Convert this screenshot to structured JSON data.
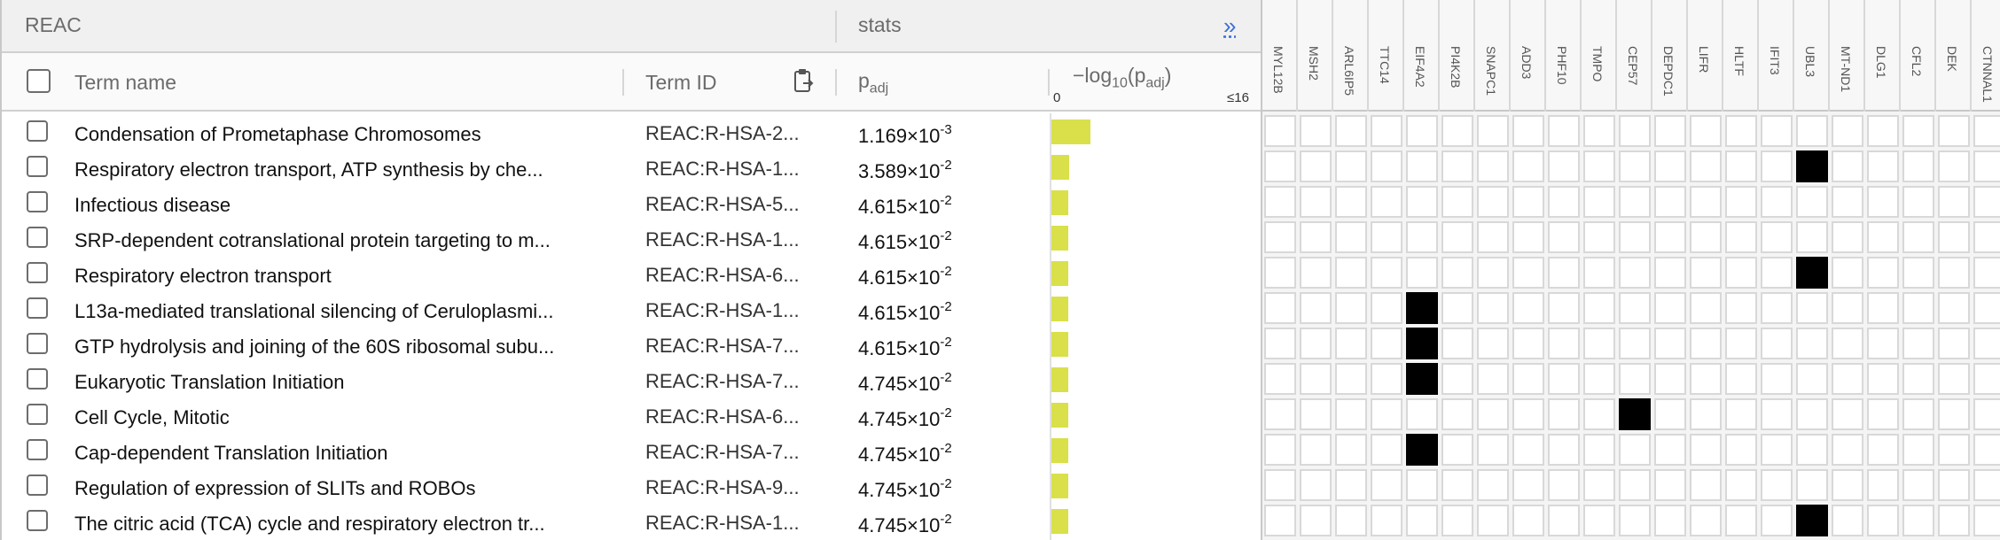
{
  "header": {
    "source": "REAC",
    "stats": "stats",
    "expand_glyph": "»"
  },
  "columns": {
    "term_name": "Term name",
    "term_id": "Term ID",
    "padj": "p",
    "padj_sub": "adj",
    "log_prefix": "−log",
    "log_base": "10",
    "log_open": "(p",
    "log_sub": "adj",
    "log_close": ")",
    "tick_min": "0",
    "tick_max": "≤16"
  },
  "rows": [
    {
      "name": "Condensation of Prometaphase Chromosomes",
      "id": "REAC:R-HSA-2...",
      "mant": "1.169×10",
      "exp": "-3",
      "bar": 1.0,
      "hits": []
    },
    {
      "name": "Respiratory electron transport, ATP synthesis by che...",
      "id": "REAC:R-HSA-1...",
      "mant": "3.589×10",
      "exp": "-2",
      "bar": 0.46,
      "hits": [
        15
      ]
    },
    {
      "name": "Infectious disease",
      "id": "REAC:R-HSA-5...",
      "mant": "4.615×10",
      "exp": "-2",
      "bar": 0.44,
      "hits": []
    },
    {
      "name": "SRP-dependent cotranslational protein targeting to m...",
      "id": "REAC:R-HSA-1...",
      "mant": "4.615×10",
      "exp": "-2",
      "bar": 0.44,
      "hits": []
    },
    {
      "name": "Respiratory electron transport",
      "id": "REAC:R-HSA-6...",
      "mant": "4.615×10",
      "exp": "-2",
      "bar": 0.44,
      "hits": [
        15
      ]
    },
    {
      "name": "L13a-mediated translational silencing of Ceruloplasmi...",
      "id": "REAC:R-HSA-1...",
      "mant": "4.615×10",
      "exp": "-2",
      "bar": 0.44,
      "hits": [
        4
      ]
    },
    {
      "name": "GTP hydrolysis and joining of the 60S ribosomal subu...",
      "id": "REAC:R-HSA-7...",
      "mant": "4.615×10",
      "exp": "-2",
      "bar": 0.44,
      "hits": [
        4
      ]
    },
    {
      "name": "Eukaryotic Translation Initiation",
      "id": "REAC:R-HSA-7...",
      "mant": "4.745×10",
      "exp": "-2",
      "bar": 0.43,
      "hits": [
        4
      ]
    },
    {
      "name": "Cell Cycle, Mitotic",
      "id": "REAC:R-HSA-6...",
      "mant": "4.745×10",
      "exp": "-2",
      "bar": 0.43,
      "hits": [
        10
      ]
    },
    {
      "name": "Cap-dependent Translation Initiation",
      "id": "REAC:R-HSA-7...",
      "mant": "4.745×10",
      "exp": "-2",
      "bar": 0.43,
      "hits": [
        4
      ]
    },
    {
      "name": "Regulation of expression of SLITs and ROBOs",
      "id": "REAC:R-HSA-9...",
      "mant": "4.745×10",
      "exp": "-2",
      "bar": 0.43,
      "hits": []
    },
    {
      "name": "The citric acid (TCA) cycle and respiratory electron tr...",
      "id": "REAC:R-HSA-1...",
      "mant": "4.745×10",
      "exp": "-2",
      "bar": 0.43,
      "hits": [
        15
      ]
    }
  ],
  "genes": [
    "MYL12B",
    "MSH2",
    "ARL6IP5",
    "TTC14",
    "EIF4A2",
    "PI4K2B",
    "SNAPC1",
    "ADD3",
    "PHF10",
    "TMPO",
    "CEP57",
    "DEPDC1",
    "LIFR",
    "HLTF",
    "IFIT3",
    "UBL3",
    "MT-ND1",
    "DLG1",
    "CFL2",
    "DEK",
    "CTNNAL1"
  ],
  "colors": {
    "bar": "#d9e04a",
    "hit": "#000000",
    "link": "#3a6fd8"
  }
}
